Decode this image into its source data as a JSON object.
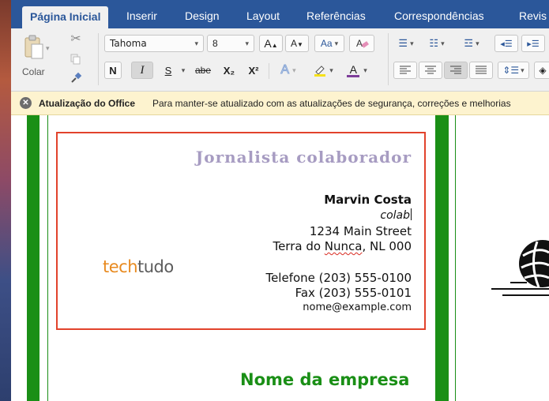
{
  "tabs": [
    {
      "label": "Página Inicial",
      "active": true
    },
    {
      "label": "Inserir"
    },
    {
      "label": "Design"
    },
    {
      "label": "Layout"
    },
    {
      "label": "Referências"
    },
    {
      "label": "Correspondências"
    },
    {
      "label": "Revis"
    }
  ],
  "clipboard": {
    "paste_label": "Colar"
  },
  "font": {
    "family": "Tahoma",
    "size": "8",
    "bold": "N",
    "italic": "I",
    "underline": "S",
    "strike": "abe",
    "subscript": "X₂",
    "superscript": "X²",
    "grow": "A",
    "shrink": "A",
    "text_effects": "A",
    "font_color": "A",
    "case": "Aa"
  },
  "notification": {
    "title": "Atualização do Office",
    "message": "Para manter-se atualizado com as atualizações de segurança, correções e melhorias"
  },
  "card": {
    "title": "Jornalista  colaborador",
    "name": "Marvin Costa",
    "role": "colab",
    "address1": "1234 Main Street",
    "address2_prefix": "Terra do ",
    "address2_squiggle": "Nunca",
    "address2_suffix": ", NL  000",
    "phone": "Telefone (203) 555-0100",
    "fax": "Fax (203) 555-0101",
    "email": "nome@example.com",
    "logo_part1": "tech",
    "logo_part2": "tudo"
  },
  "company": "Nome da empresa",
  "colors": {
    "ribbon_blue": "#2b579a",
    "border_green": "#1a8f16",
    "card_red": "#e2432c",
    "title_lavender": "#a79cc2",
    "logo_orange": "#e88a1f"
  },
  "icons": [
    "paste-icon",
    "cut-icon",
    "copy-icon",
    "format-painter-icon",
    "clear-formatting-icon",
    "bullets-icon",
    "numbering-icon",
    "multilevel-list-icon",
    "decrease-indent-icon",
    "increase-indent-icon",
    "align-left-icon",
    "center-icon",
    "align-right-icon",
    "justify-icon",
    "line-spacing-icon",
    "shading-icon",
    "notification-close-icon",
    "globe-icon"
  ]
}
